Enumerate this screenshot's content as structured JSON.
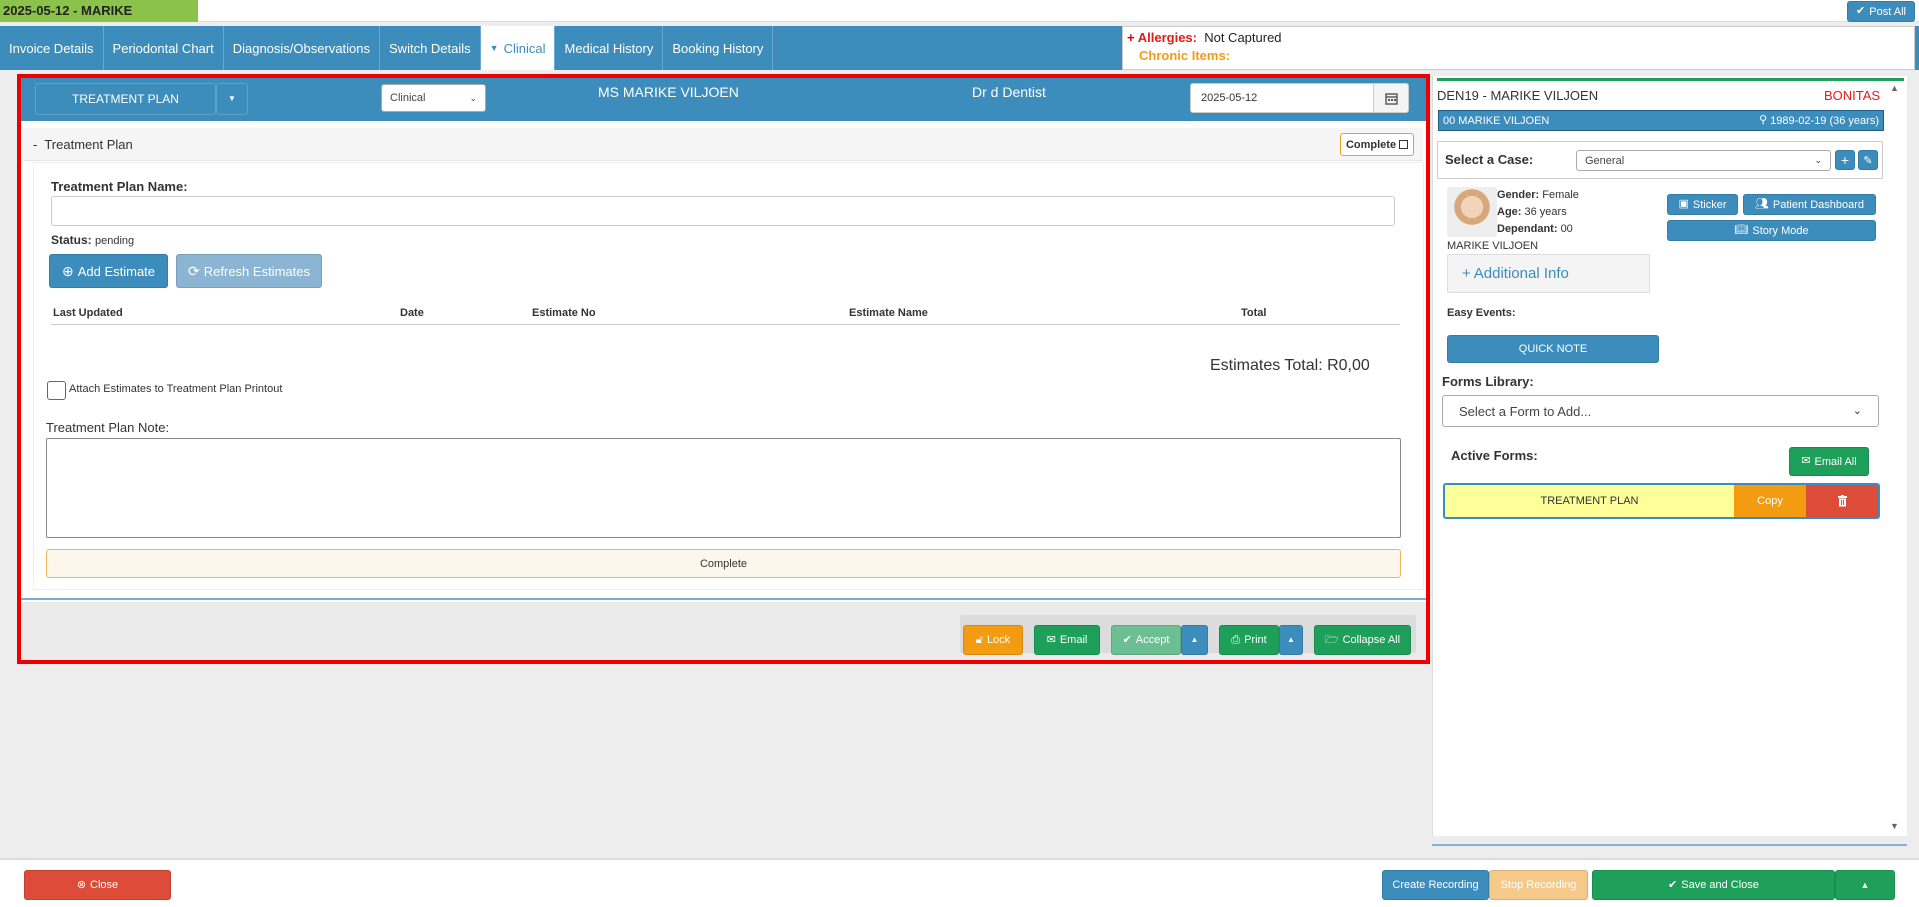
{
  "top_bar": {
    "date_patient": "2025-05-12 - MARIKE",
    "post_all": "Post All"
  },
  "tabs": [
    {
      "label": "Invoice Details"
    },
    {
      "label": "Periodontal Chart"
    },
    {
      "label": "Diagnosis/Observations"
    },
    {
      "label": "Switch Details"
    },
    {
      "label": "Clinical"
    },
    {
      "label": "Medical History"
    },
    {
      "label": "Booking History"
    }
  ],
  "alerts": {
    "allergies_label": "Allergies:",
    "allergies_value": "Not Captured",
    "chronic_label": "Chronic Items:"
  },
  "form_header": {
    "form_title": "TREATMENT PLAN",
    "category_select": "Clinical",
    "patient_name": "MS MARIKE VILJOEN",
    "doctor": "Dr d Dentist",
    "date": "2025-05-12"
  },
  "treatment_plan": {
    "section_title": "Treatment Plan",
    "complete_toggle": "Complete",
    "name_label": "Treatment Plan Name:",
    "name_value": "",
    "status_label": "Status:",
    "status_value": "pending",
    "add_estimate": "Add Estimate",
    "refresh_estimates": "Refresh Estimates",
    "table_headers": [
      "Last Updated",
      "Date",
      "Estimate No",
      "Estimate Name",
      "Total"
    ],
    "estimates_total": "Estimates Total: R0,00",
    "attach_label": "Attach Estimates to Treatment Plan Printout",
    "note_label": "Treatment Plan Note:",
    "note_value": "",
    "complete_button": "Complete"
  },
  "form_actions": {
    "lock": "Lock",
    "email": "Email",
    "accept": "Accept",
    "print": "Print",
    "collapse_all": "Collapse All"
  },
  "sidebar": {
    "patient_code": "DEN19 - MARIKE VILJOEN",
    "medical_aid": "BONITAS",
    "member": "00 MARIKE VILJOEN",
    "dob": "1989-02-19 (36 years)",
    "select_case_label": "Select a Case:",
    "case_value": "General",
    "gender_label": "Gender:",
    "gender_value": "Female",
    "age_label": "Age:",
    "age_value": "36 years",
    "dependant_label": "Dependant:",
    "dependant_value": "00",
    "patient_name": "MARIKE VILJOEN",
    "additional_info": "Additional Info",
    "sticker": "Sticker",
    "patient_dashboard": "Patient Dashboard",
    "story_mode": "Story Mode",
    "easy_events": "Easy Events:",
    "quick_note": "QUICK NOTE",
    "forms_library": "Forms Library:",
    "form_select_placeholder": "Select a Form to Add...",
    "active_forms": "Active Forms:",
    "email_all": "Email All",
    "active_form_name": "TREATMENT PLAN",
    "copy": "Copy"
  },
  "footer": {
    "close": "Close",
    "create_recording": "Create Recording",
    "stop_recording": "Stop Recording",
    "save_and_close": "Save and Close"
  },
  "colors": {
    "primary": "#3c8dbc",
    "success": "#1ea05a",
    "warning": "#f39c12",
    "danger": "#dd4b39",
    "highlight": "#ff0000"
  }
}
